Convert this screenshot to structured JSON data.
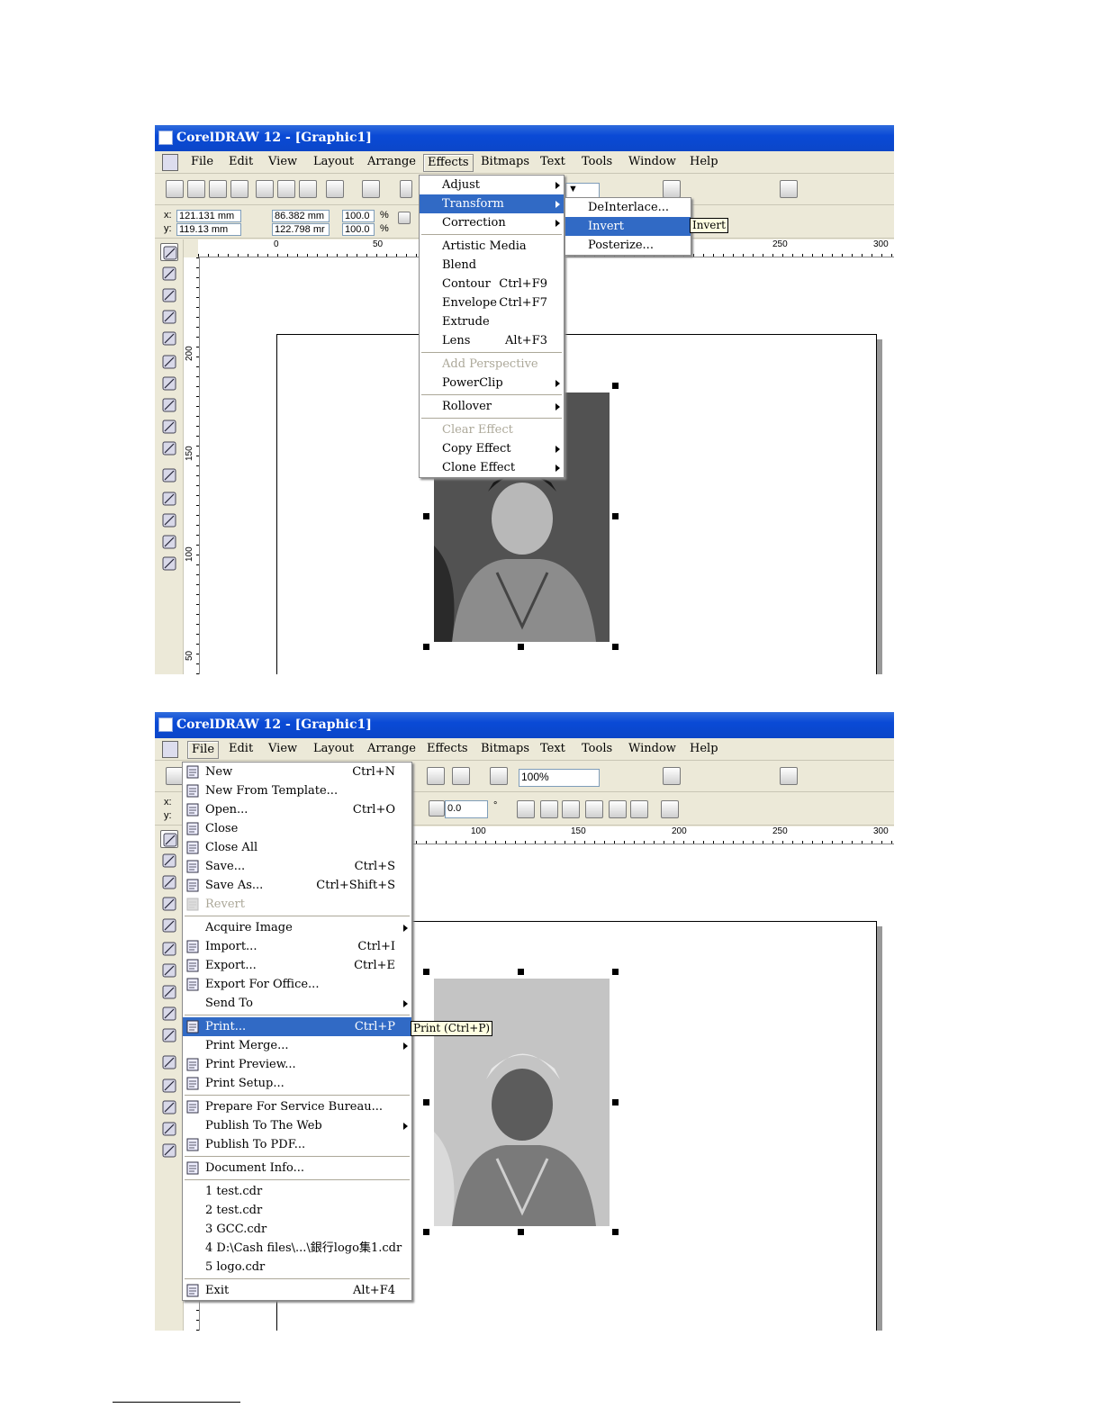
{
  "screenshot1": {
    "title": "CorelDRAW 12 - [Graphic1]",
    "menubar": [
      "File",
      "Edit",
      "View",
      "Layout",
      "Arrange",
      "Effects",
      "Bitmaps",
      "Text",
      "Tools",
      "Window",
      "Help"
    ],
    "open_menu": "Effects",
    "props": {
      "x_label": "x:",
      "y_label": "y:",
      "x": "121.131 mm",
      "y": "119.13 mm",
      "w": "86.382 mm",
      "h": "122.798 mr",
      "sx": "100.0",
      "sy": "100.0",
      "pct": "%"
    },
    "ruler_h": [
      "0",
      "50",
      "250",
      "300"
    ],
    "ruler_v": [
      "200",
      "150",
      "100",
      "50"
    ],
    "effects_menu": [
      {
        "label": "Adjust",
        "sub": true
      },
      {
        "label": "Transform",
        "sub": true,
        "highlight": true
      },
      {
        "label": "Correction",
        "sub": true
      },
      {
        "sep": true
      },
      {
        "label": "Artistic Media"
      },
      {
        "label": "Blend"
      },
      {
        "label": "Contour",
        "shortcut": "Ctrl+F9"
      },
      {
        "label": "Envelope",
        "shortcut": "Ctrl+F7"
      },
      {
        "label": "Extrude"
      },
      {
        "label": "Lens",
        "shortcut": "Alt+F3"
      },
      {
        "sep": true
      },
      {
        "label": "Add Perspective",
        "disabled": true
      },
      {
        "label": "PowerClip",
        "sub": true
      },
      {
        "sep": true
      },
      {
        "label": "Rollover",
        "sub": true
      },
      {
        "sep": true
      },
      {
        "label": "Clear Effect",
        "disabled": true
      },
      {
        "label": "Copy Effect",
        "sub": true
      },
      {
        "label": "Clone Effect",
        "sub": true
      }
    ],
    "transform_menu": [
      {
        "label": "DeInterlace..."
      },
      {
        "label": "Invert",
        "highlight": true
      },
      {
        "label": "Posterize..."
      }
    ],
    "tooltip": "Invert"
  },
  "screenshot2": {
    "title": "CorelDRAW 12 - [Graphic1]",
    "menubar": [
      "File",
      "Edit",
      "View",
      "Layout",
      "Arrange",
      "Effects",
      "Bitmaps",
      "Text",
      "Tools",
      "Window",
      "Help"
    ],
    "open_menu": "File",
    "zoom": "100%",
    "angle": "0.0",
    "degree": "°",
    "xy_labels": {
      "x": "x:",
      "y": "y:"
    },
    "ruler_h": [
      "100",
      "150",
      "200",
      "250",
      "300"
    ],
    "file_menu": [
      {
        "label": "New",
        "shortcut": "Ctrl+N",
        "icon": "new-doc"
      },
      {
        "label": "New From Template...",
        "icon": "template"
      },
      {
        "label": "Open...",
        "shortcut": "Ctrl+O",
        "icon": "open"
      },
      {
        "label": "Close",
        "icon": "close-doc"
      },
      {
        "label": "Close All",
        "icon": "close-all"
      },
      {
        "label": "Save...",
        "shortcut": "Ctrl+S",
        "icon": "save"
      },
      {
        "label": "Save As...",
        "shortcut": "Ctrl+Shift+S",
        "icon": "save-as"
      },
      {
        "label": "Revert",
        "disabled": true,
        "icon": "revert"
      },
      {
        "sep": true
      },
      {
        "label": "Acquire Image",
        "sub": true
      },
      {
        "label": "Import...",
        "shortcut": "Ctrl+I",
        "icon": "import"
      },
      {
        "label": "Export...",
        "shortcut": "Ctrl+E",
        "icon": "export"
      },
      {
        "label": "Export For Office...",
        "icon": "export-office"
      },
      {
        "label": "Send To",
        "sub": true
      },
      {
        "sep": true
      },
      {
        "label": "Print...",
        "shortcut": "Ctrl+P",
        "highlight": true,
        "icon": "print"
      },
      {
        "label": "Print Merge...",
        "sub": true
      },
      {
        "label": "Print Preview...",
        "icon": "print-preview"
      },
      {
        "label": "Print Setup...",
        "icon": "print-setup"
      },
      {
        "sep": true
      },
      {
        "label": "Prepare For Service Bureau...",
        "icon": "bureau"
      },
      {
        "label": "Publish To The Web",
        "sub": true
      },
      {
        "label": "Publish To PDF...",
        "icon": "pdf"
      },
      {
        "sep": true
      },
      {
        "label": "Document Info...",
        "icon": "info"
      },
      {
        "sep": true
      },
      {
        "label": "1 test.cdr"
      },
      {
        "label": "2 test.cdr"
      },
      {
        "label": "3 GCC.cdr"
      },
      {
        "label": "4 D:\\Cash files\\...\\銀行logo集1.cdr"
      },
      {
        "label": "5 logo.cdr"
      },
      {
        "sep": true
      },
      {
        "label": "Exit",
        "shortcut": "Alt+F4",
        "icon": "exit"
      }
    ],
    "tooltip": "Print (Ctrl+P)"
  },
  "colors": {
    "titlebar": "#0a4ad6",
    "highlight": "#316ac5",
    "menu_bg": "#ece9d8"
  }
}
